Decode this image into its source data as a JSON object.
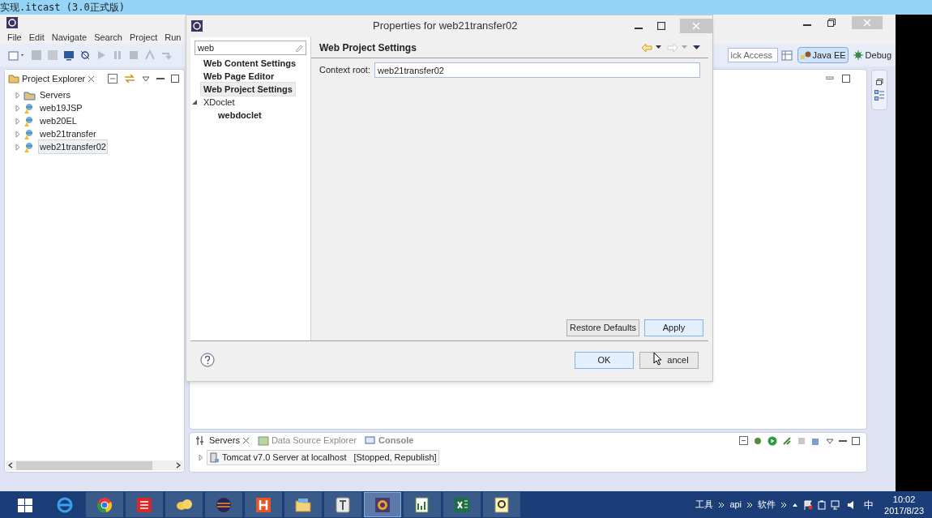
{
  "screen_title": "实现.itcast (3.0正式版)",
  "workbench": {
    "menu": [
      "File",
      "Edit",
      "Navigate",
      "Search",
      "Project",
      "Run"
    ],
    "quick_access": "ick Access",
    "perspectives": [
      {
        "label": "Java EE",
        "selected": true
      },
      {
        "label": "Debug",
        "selected": false
      }
    ],
    "project_explorer": {
      "title": "Project Explorer",
      "items": [
        {
          "kind": "folder",
          "label": "Servers",
          "expanded": false,
          "selected": false
        },
        {
          "kind": "project",
          "label": "web19JSP",
          "expanded": false,
          "selected": false
        },
        {
          "kind": "project",
          "label": "web20EL",
          "expanded": false,
          "selected": false
        },
        {
          "kind": "project",
          "label": "web21transfer",
          "expanded": false,
          "selected": false
        },
        {
          "kind": "project",
          "label": "web21transfer02",
          "expanded": false,
          "selected": true
        }
      ]
    },
    "servers_view": {
      "tabs": [
        {
          "label": "Servers",
          "selected": true
        },
        {
          "label": "Data Source Explorer",
          "selected": false
        },
        {
          "label": "Console",
          "selected": false
        }
      ],
      "rows": [
        {
          "label": "Tomcat v7.0 Server at localhost",
          "status": "[Stopped, Republish]",
          "expanded": false
        }
      ]
    }
  },
  "dialog": {
    "title": "Properties for web21transfer02",
    "filter": "web",
    "tree": [
      {
        "label": "Web Content Settings",
        "matched": true,
        "selected": false
      },
      {
        "label": "Web Page Editor",
        "matched": true,
        "selected": false
      },
      {
        "label": "Web Project Settings",
        "matched": true,
        "selected": true
      },
      {
        "label": "XDoclet",
        "matched": false,
        "selected": false,
        "expanded": true,
        "children": [
          {
            "label": "webdoclet",
            "matched": true,
            "selected": false
          }
        ]
      }
    ],
    "page_title": "Web Project Settings",
    "fields": [
      {
        "label": "Context root:",
        "value": "web21transfer02"
      }
    ],
    "page_buttons": [
      {
        "label": "Restore Defaults",
        "default": false
      },
      {
        "label": "Apply",
        "default": true
      }
    ],
    "footer_buttons": [
      {
        "label": "OK",
        "default": true
      },
      {
        "label": "ancel",
        "default": false
      }
    ]
  },
  "taskbar": {
    "tray_labels": [
      "工具",
      "api",
      "软件"
    ],
    "input_method": "中",
    "time": "10:02",
    "date": "2017/8/23"
  }
}
